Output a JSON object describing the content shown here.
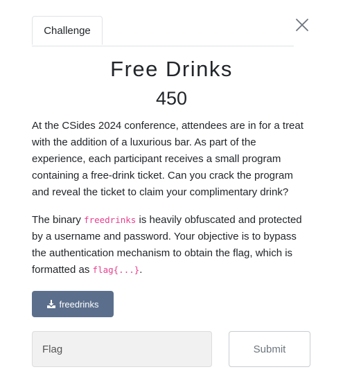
{
  "tabs": [
    {
      "label": "Challenge",
      "active": true
    }
  ],
  "challenge": {
    "name": "Free Drinks",
    "points": "450",
    "description": {
      "paragraph1": "At the CSides 2024 conference, attendees are in for a treat with the addition of a luxurious bar. As part of the experience, each participant receives a small program containing a free-drink ticket. Can you crack the program and reveal the ticket to claim your complimentary drink?",
      "paragraph2_before": "The binary ",
      "paragraph2_code": "freedrinks",
      "paragraph2_middle": " is heavily obfuscated and protected by a username and password. Your objective is to bypass the authentication mechanism to obtain the flag, which is formatted as ",
      "paragraph2_code2": "flag{...}",
      "paragraph2_after": "."
    }
  },
  "files": [
    {
      "label": "freedrinks",
      "icon": "download-icon"
    }
  ],
  "form": {
    "flag_placeholder": "Flag",
    "flag_value": "",
    "submit_label": "Submit"
  },
  "icons": {
    "close": "close-icon"
  },
  "colors": {
    "file_button_bg": "#5b6f8d",
    "code_text": "#e83e8c",
    "input_bg": "#f1f1f1"
  }
}
